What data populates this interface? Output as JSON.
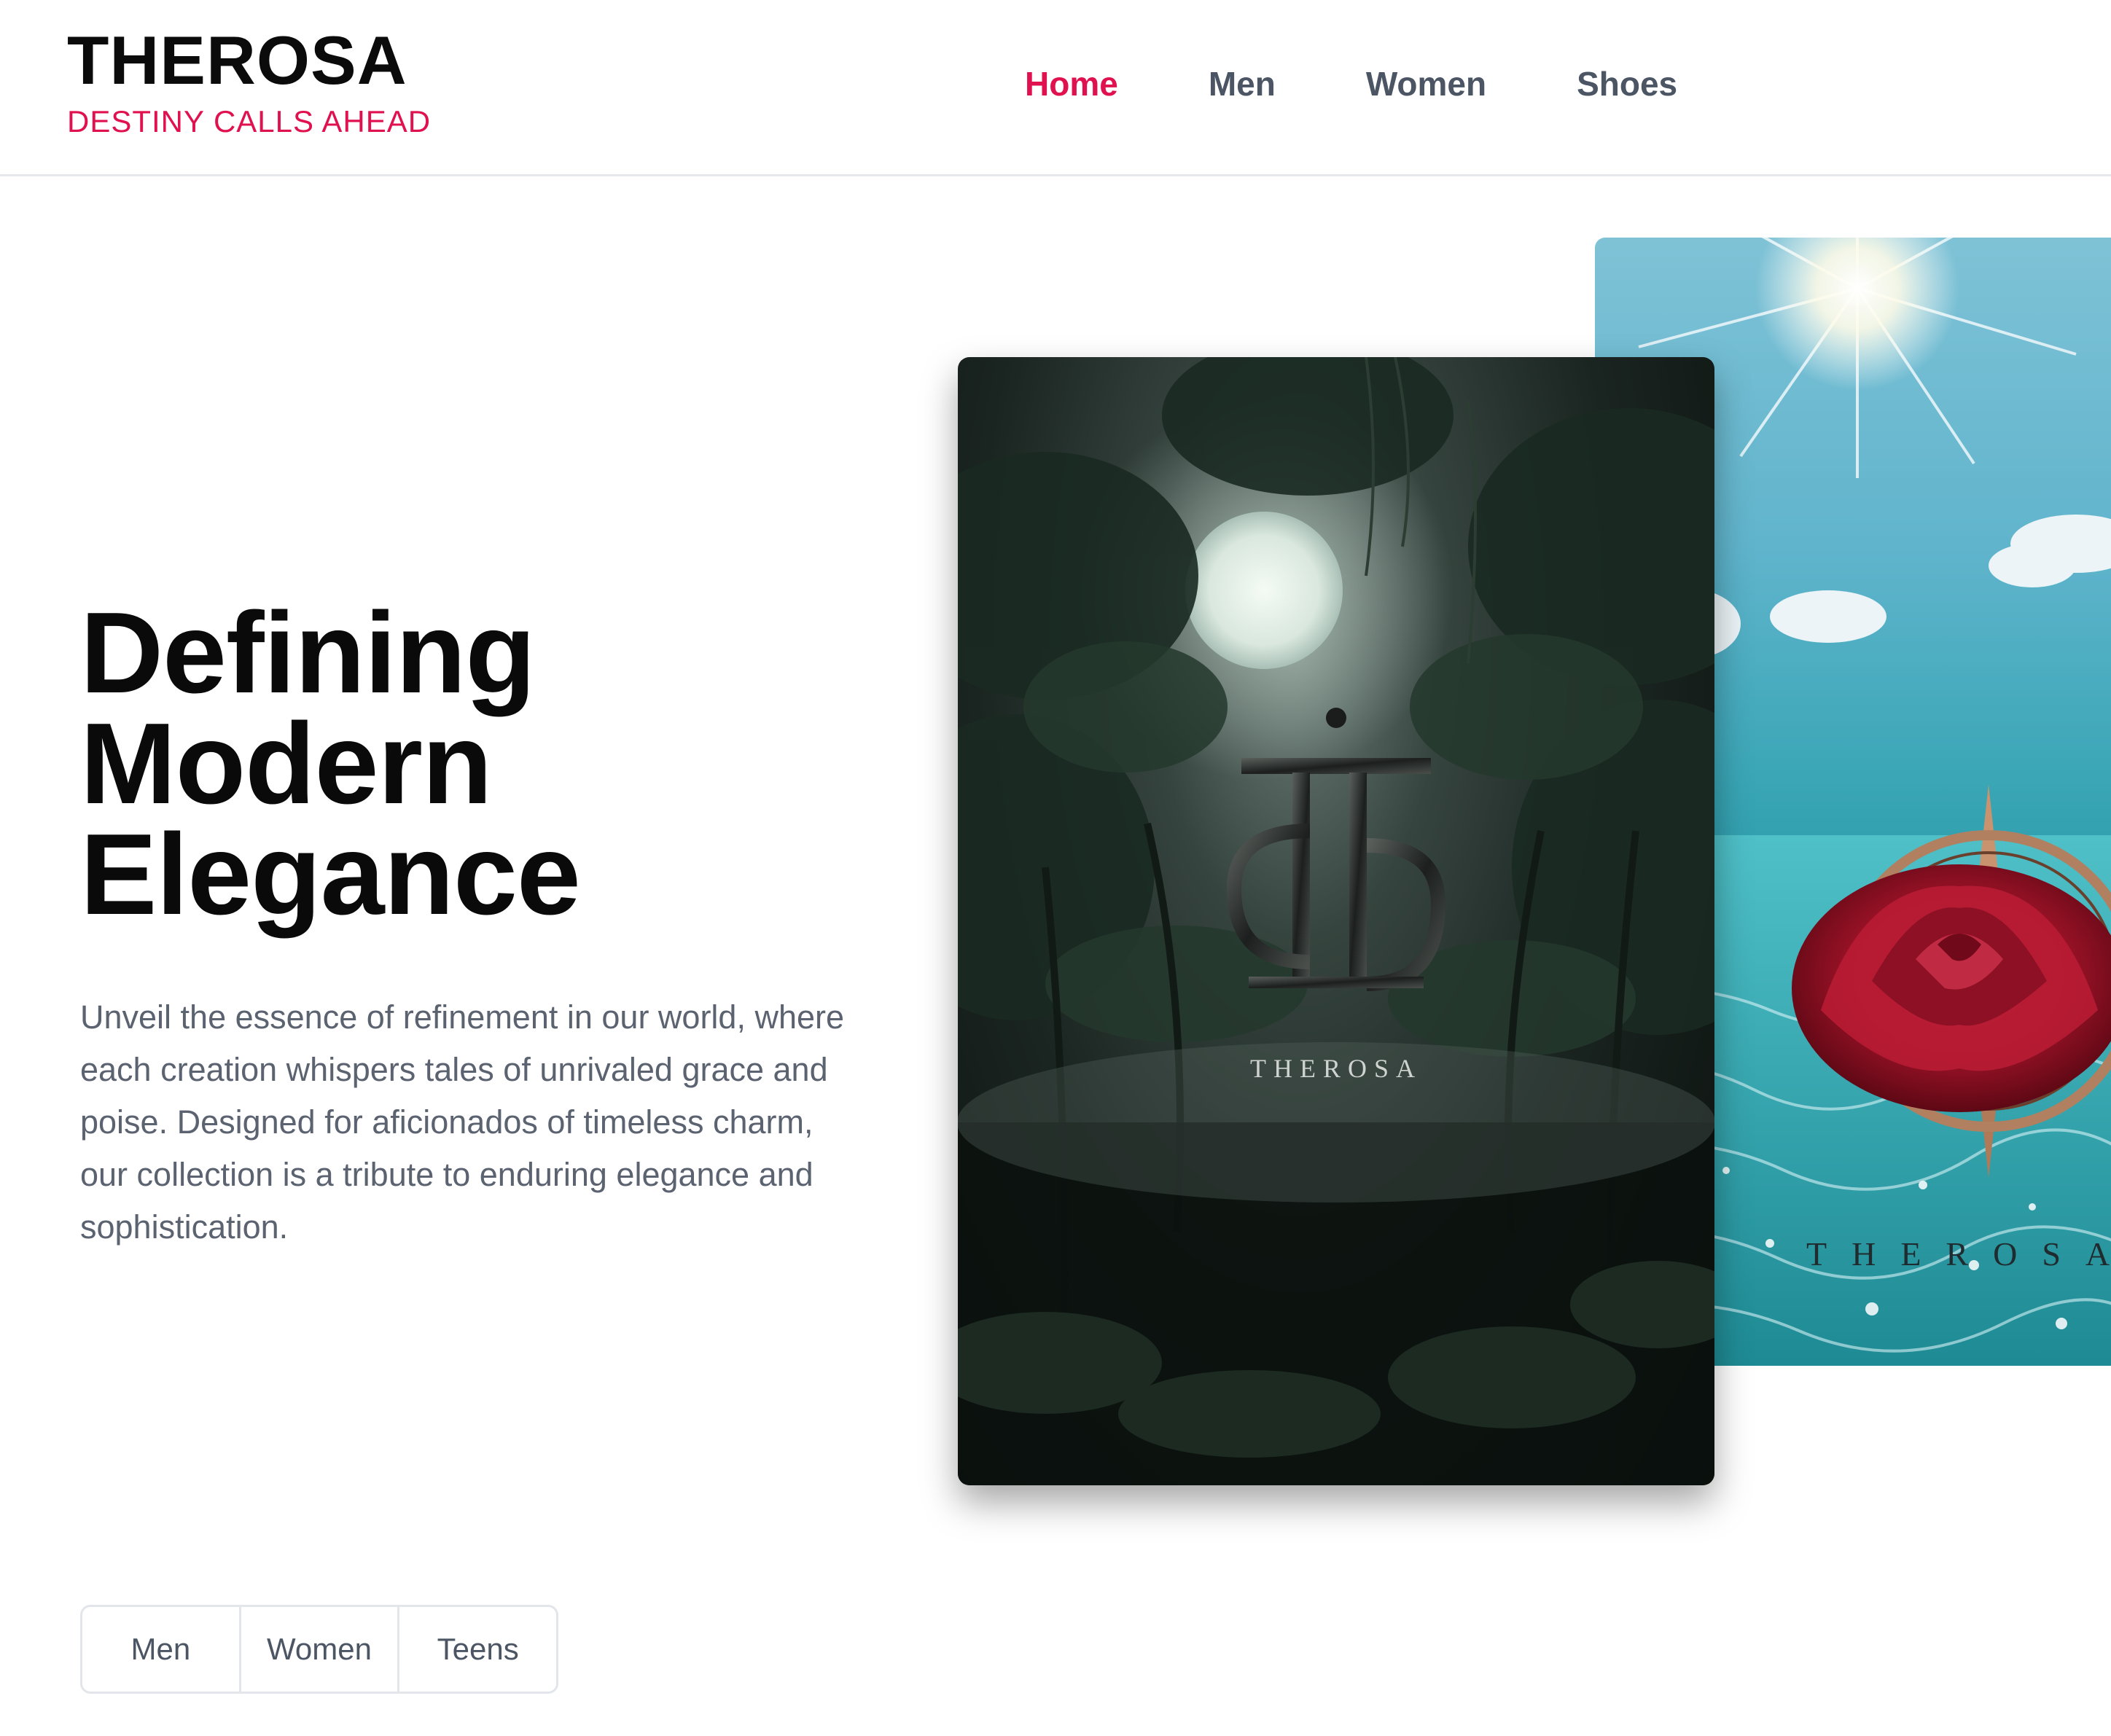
{
  "brand": {
    "title": "THEROSA",
    "tagline": "DESTINY CALLS AHEAD"
  },
  "nav": {
    "items": [
      {
        "label": "Home",
        "active": true
      },
      {
        "label": "Men",
        "active": false
      },
      {
        "label": "Women",
        "active": false
      },
      {
        "label": "Shoes",
        "active": false
      }
    ]
  },
  "hero": {
    "title_lines": [
      "Defining",
      "Modern",
      "Elegance"
    ],
    "description": "Unveil the essence of refinement in our world, where each creation whispers tales of unrivaled grace and poise. Designed for aficionados of timeless charm, our collection is a tribute to enduring elegance and sophistication."
  },
  "tabs": [
    "Men",
    "Women",
    "Teens"
  ],
  "cards": {
    "front_brand": "THEROSA",
    "back_brand": "THEROSA"
  },
  "colors": {
    "accent": "#e0114f",
    "nav_text": "#4b5563",
    "body_text": "#5b6270",
    "heading": "#0a0a0a"
  }
}
